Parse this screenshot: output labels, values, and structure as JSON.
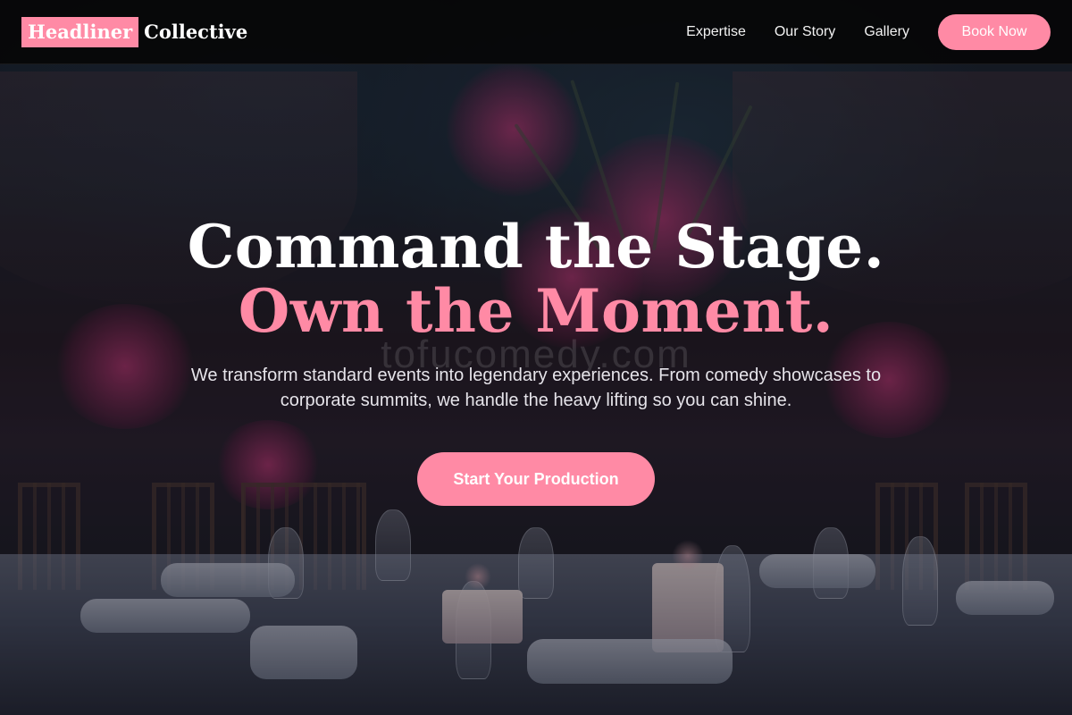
{
  "brand": {
    "highlight": "Headliner",
    "rest": "Collective",
    "accent_color": "#ff8aa5"
  },
  "nav": {
    "links": [
      "Expertise",
      "Our Story",
      "Gallery"
    ],
    "cta_label": "Book Now"
  },
  "hero": {
    "title_line1": "Command the Stage.",
    "title_line2": "Own the Moment.",
    "watermark": "tofucomedy.com",
    "subtitle": "We transform standard events into legendary experiences. From comedy showcases to corporate summits, we handle the heavy lifting so you can shine.",
    "cta_label": "Start Your Production",
    "background_image": "banquet-table-flowers-candles-photo"
  }
}
